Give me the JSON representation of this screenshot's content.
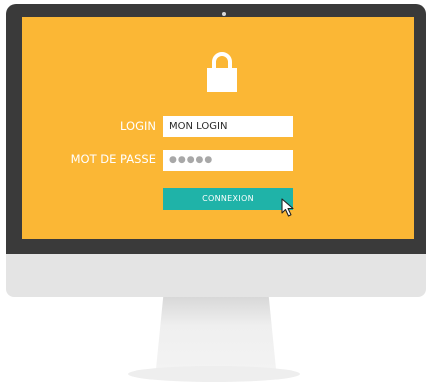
{
  "form": {
    "login_label": "LOGIN",
    "login_value": "MON LOGIN",
    "password_label": "MOT DE PASSE",
    "password_masked": "●●●●●",
    "submit_label": "CONNEXION"
  },
  "colors": {
    "screen_background": "#fbb735",
    "bezel": "#3a3a3a",
    "button": "#1fb3a8",
    "field_background": "#ffffff",
    "chin": "#e4e4e4"
  },
  "icons": {
    "lock": "lock-icon",
    "cursor": "mouse-pointer-icon"
  }
}
